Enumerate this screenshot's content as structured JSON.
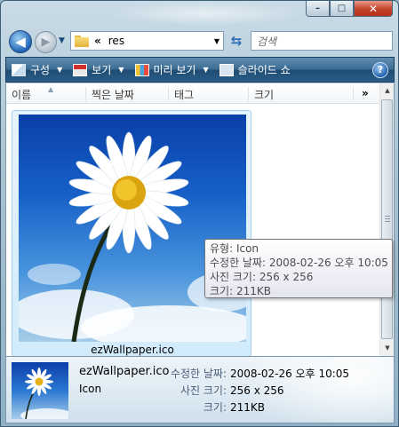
{
  "window": {
    "caption_minimize": "–",
    "caption_maximize": "□",
    "caption_close": "✕"
  },
  "address_bar": {
    "breadcrumb_separator": "«",
    "path": "res",
    "search_placeholder": "검색"
  },
  "command_bar": {
    "items": [
      {
        "label": "구성",
        "icon": "organize-icon"
      },
      {
        "label": "보기",
        "icon": "views-icon"
      },
      {
        "label": "미리 보기",
        "icon": "preview-icon"
      },
      {
        "label": "슬라이드 쇼",
        "icon": "slideshow-icon"
      }
    ],
    "help_label": "?"
  },
  "columns": {
    "headers": [
      "이름",
      "찍은 날짜",
      "태그",
      "크기"
    ],
    "more": "»"
  },
  "file": {
    "name": "ezWallpaper.ico"
  },
  "tooltip": {
    "lines": [
      "유형: Icon",
      "수정한 날짜: 2008-02-26 오후 10:05",
      "사진 크기: 256 x 256",
      "크기: 211KB"
    ]
  },
  "details_pane": {
    "file_name": "ezWallpaper.ico",
    "file_type": "Icon",
    "fields": [
      {
        "key": "수정한 날짜:",
        "value": "2008-02-26 오후 10:05"
      },
      {
        "key": "사진 크기:",
        "value": "256 x 256"
      },
      {
        "key": "크기:",
        "value": "211KB"
      }
    ]
  },
  "colors": {
    "command_bar": "#2a5d86",
    "selection": "#d2ebfb",
    "sky": "#1660c8"
  }
}
